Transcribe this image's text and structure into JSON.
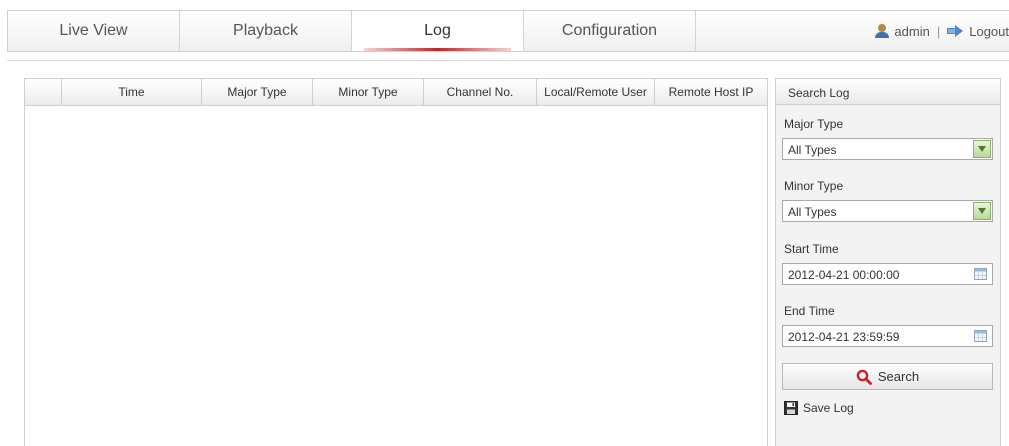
{
  "nav": {
    "tabs": [
      {
        "label": "Live View"
      },
      {
        "label": "Playback"
      },
      {
        "label": "Log"
      },
      {
        "label": "Configuration"
      }
    ],
    "active_tab": "Log",
    "user": "admin",
    "separator": "|",
    "logout": "Logout"
  },
  "table": {
    "columns": [
      "",
      "Time",
      "Major Type",
      "Minor Type",
      "Channel No.",
      "Local/Remote User",
      "Remote Host IP"
    ],
    "rows": []
  },
  "search": {
    "title": "Search Log",
    "major_type_label": "Major Type",
    "major_type_value": "All Types",
    "minor_type_label": "Minor Type",
    "minor_type_value": "All Types",
    "start_time_label": "Start Time",
    "start_time_value": "2012-04-21 00:00:00",
    "end_time_label": "End Time",
    "end_time_value": "2012-04-21 23:59:59",
    "search_button": "Search",
    "save_log": "Save Log"
  },
  "colors": {
    "active_tab_underline": "#b8282c",
    "search_icon": "#c0282c",
    "dropdown_arrow": "#7aa653"
  },
  "icons": {
    "user": "user-icon",
    "logout": "logout-icon",
    "dropdown": "chevron-down-icon",
    "calendar": "calendar-icon",
    "search": "search-icon",
    "save": "save-icon"
  }
}
